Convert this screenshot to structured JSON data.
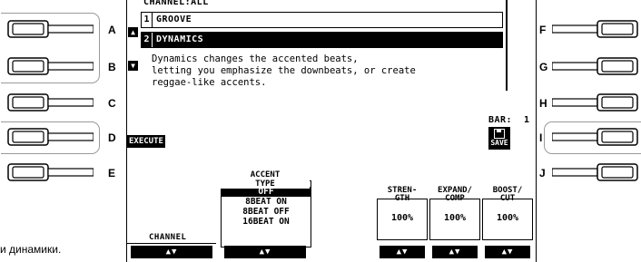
{
  "caption": "и динамики.",
  "side_buttons": {
    "left": [
      "A",
      "B",
      "C",
      "D",
      "E"
    ],
    "right": [
      "F",
      "G",
      "H",
      "I",
      "J"
    ]
  },
  "lcd": {
    "header": "CHANNEL:ALL",
    "list": [
      {
        "num": "1",
        "name": "GROOVE"
      },
      {
        "num": "2",
        "name": "DYNAMICS"
      }
    ],
    "description": [
      "Dynamics changes the accented beats,",
      "letting you emphasize the downbeats, or create",
      "reggae-like accents."
    ],
    "bar_label": "BAR:",
    "bar_value": "1",
    "execute_label": "EXECUTE",
    "save_label": "SAVE",
    "channel_label": "CHANNEL",
    "accent_type": {
      "title_line1": "ACCENT",
      "title_line2": "TYPE",
      "options": [
        "OFF",
        "8BEAT ON",
        "8BEAT OFF",
        "16BEAT ON"
      ],
      "selected": "OFF"
    },
    "params": [
      {
        "title_line1": "STREN-",
        "title_line2": "GTH",
        "value": "100%"
      },
      {
        "title_line1": "EXPAND/",
        "title_line2": "COMP",
        "value": "100%"
      },
      {
        "title_line1": "BOOST/",
        "title_line2": "CUT",
        "value": "100%"
      }
    ],
    "updown_symbol": "▲▼"
  }
}
